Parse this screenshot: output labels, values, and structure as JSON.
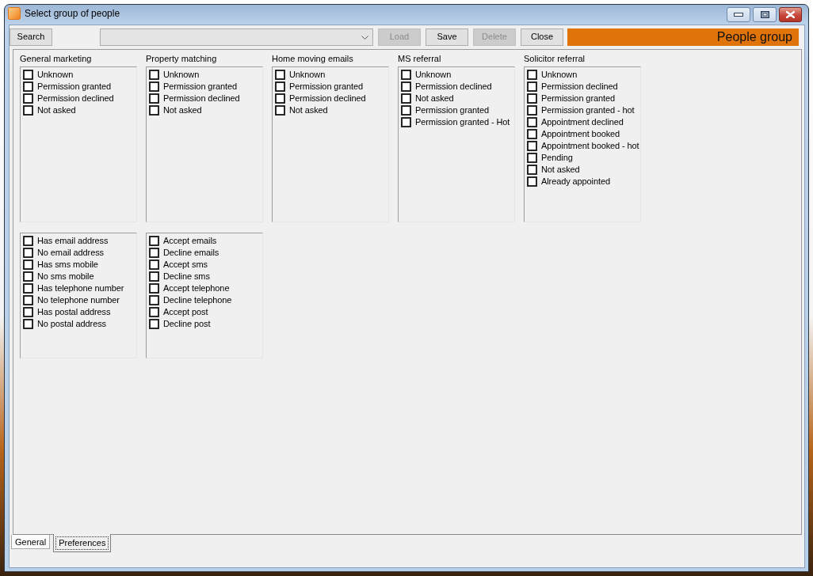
{
  "window": {
    "title": "Select group of people"
  },
  "toolbar": {
    "search_button": {
      "label": "Search"
    },
    "actions": [
      {
        "label": "Load",
        "disabled": true
      },
      {
        "label": "Save",
        "disabled": false
      },
      {
        "label": "Delete",
        "disabled": true
      },
      {
        "label": "Close",
        "disabled": false
      }
    ],
    "banner": {
      "text": "People group"
    }
  },
  "filter_rows": [
    [
      {
        "title": "General marketing",
        "options": [
          {
            "label": "Unknown",
            "checked": false
          },
          {
            "label": "Permission granted",
            "checked": false
          },
          {
            "label": "Permission declined",
            "checked": false
          },
          {
            "label": "Not asked",
            "checked": false
          }
        ]
      },
      {
        "title": "Property matching",
        "options": [
          {
            "label": "Unknown",
            "checked": false
          },
          {
            "label": "Permission granted",
            "checked": false
          },
          {
            "label": "Permission declined",
            "checked": false
          },
          {
            "label": "Not asked",
            "checked": false
          }
        ]
      },
      {
        "title": "Home moving emails",
        "options": [
          {
            "label": "Unknown",
            "checked": false
          },
          {
            "label": "Permission granted",
            "checked": false
          },
          {
            "label": "Permission declined",
            "checked": false
          },
          {
            "label": "Not asked",
            "checked": false
          }
        ]
      },
      {
        "title": "MS referral",
        "options": [
          {
            "label": "Unknown",
            "checked": false
          },
          {
            "label": "Permission declined",
            "checked": false
          },
          {
            "label": "Not asked",
            "checked": false
          },
          {
            "label": "Permission granted",
            "checked": false
          },
          {
            "label": "Permission granted - Hot",
            "checked": false
          }
        ]
      },
      {
        "title": "Solicitor referral",
        "options": [
          {
            "label": "Unknown",
            "checked": false
          },
          {
            "label": "Permission declined",
            "checked": false
          },
          {
            "label": "Permission granted",
            "checked": false
          },
          {
            "label": "Permission granted - hot",
            "checked": false
          },
          {
            "label": "Appointment declined",
            "checked": false
          },
          {
            "label": "Appointment booked",
            "checked": false
          },
          {
            "label": "Appointment booked - hot",
            "checked": false
          },
          {
            "label": "Pending",
            "checked": false
          },
          {
            "label": "Not asked",
            "checked": false
          },
          {
            "label": "Already appointed",
            "checked": false
          }
        ]
      }
    ],
    [
      {
        "options": [
          {
            "label": "Has email address",
            "checked": false
          },
          {
            "label": "No email address",
            "checked": false
          },
          {
            "label": "Has sms mobile",
            "checked": false
          },
          {
            "label": "No sms mobile",
            "checked": false
          },
          {
            "label": "Has telephone number",
            "checked": false
          },
          {
            "label": "No telephone number",
            "checked": false
          },
          {
            "label": "Has postal address",
            "checked": false
          },
          {
            "label": "No postal address",
            "checked": false
          }
        ]
      },
      {
        "options": [
          {
            "label": "Accept emails",
            "checked": false
          },
          {
            "label": "Decline emails",
            "checked": false
          },
          {
            "label": "Accept sms",
            "checked": false
          },
          {
            "label": "Decline sms",
            "checked": false
          },
          {
            "label": "Accept telephone",
            "checked": false
          },
          {
            "label": "Decline telephone",
            "checked": false
          },
          {
            "label": "Accept post",
            "checked": false
          },
          {
            "label": "Decline post",
            "checked": false
          }
        ]
      }
    ]
  ],
  "tabs": [
    {
      "label": "General",
      "selected": false
    },
    {
      "label": "Preferences",
      "selected": true
    }
  ]
}
